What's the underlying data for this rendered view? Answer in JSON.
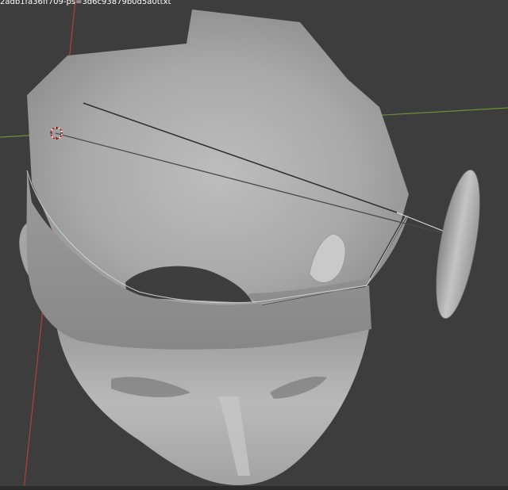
{
  "viewport": {
    "overlay_filename": "2adb1fa36ff709-ps=3d6c93879b0d5a0ttxt",
    "colors": {
      "background": "#3d3d3d",
      "x_axis": "#c0504d",
      "y_axis": "#7a9a3a",
      "mesh_light": "#b8b8b8",
      "mesh_dark": "#7a7a7a",
      "cursor": "#d01010"
    },
    "objects": [
      "3d-cursor",
      "x-axis-line",
      "y-axis-line",
      "head-mesh",
      "band-mesh",
      "ear-left",
      "ear-right",
      "ellipse-disc",
      "line-edges"
    ]
  }
}
